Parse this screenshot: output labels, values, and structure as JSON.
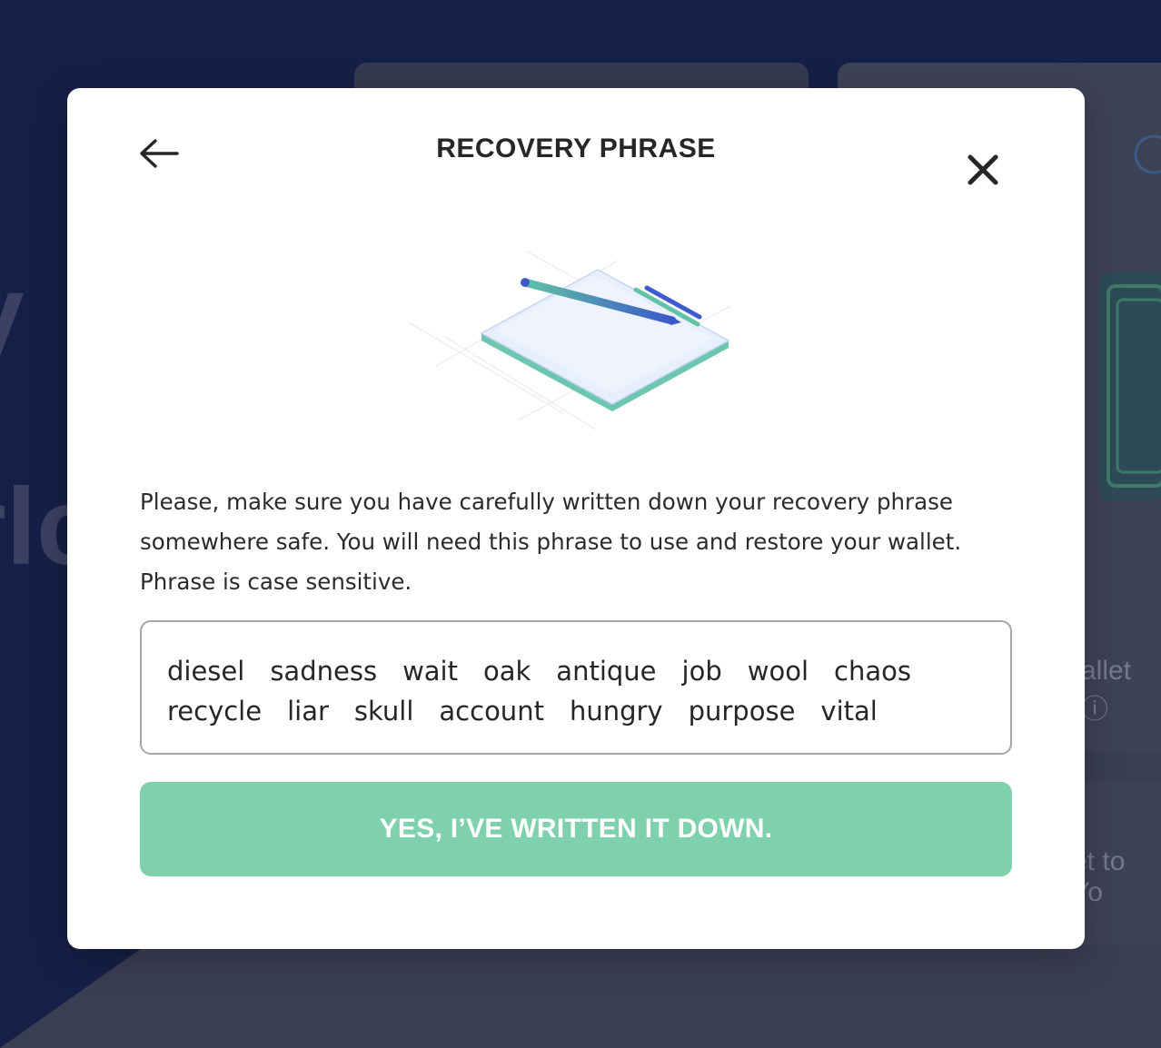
{
  "background": {
    "hero_line_1": "y",
    "hero_line_2": "rlc",
    "side_text_1": "allet ⓘ",
    "side_text_2": "et to Yo"
  },
  "modal": {
    "title": "RECOVERY PHRASE",
    "description": "Please, make sure you have carefully written down your recovery phrase somewhere safe. You will need this phrase to use and restore your wallet. Phrase is case sensitive.",
    "phrase_words": [
      "diesel",
      "sadness",
      "wait",
      "oak",
      "antique",
      "job",
      "wool",
      "chaos",
      "recycle",
      "liar",
      "skull",
      "account",
      "hungry",
      "purpose",
      "vital"
    ],
    "confirm_label": "YES, I’VE WRITTEN IT DOWN."
  },
  "icons": {
    "back": "arrow-left-icon",
    "close": "close-icon",
    "illustration": "notebook-pen-illustration"
  },
  "colors": {
    "backdrop": "#161f47",
    "modal_bg": "#ffffff",
    "button_bg": "#7fd1ad",
    "button_text": "#ffffff",
    "title_text": "#262626",
    "border": "#a6a6a6"
  }
}
